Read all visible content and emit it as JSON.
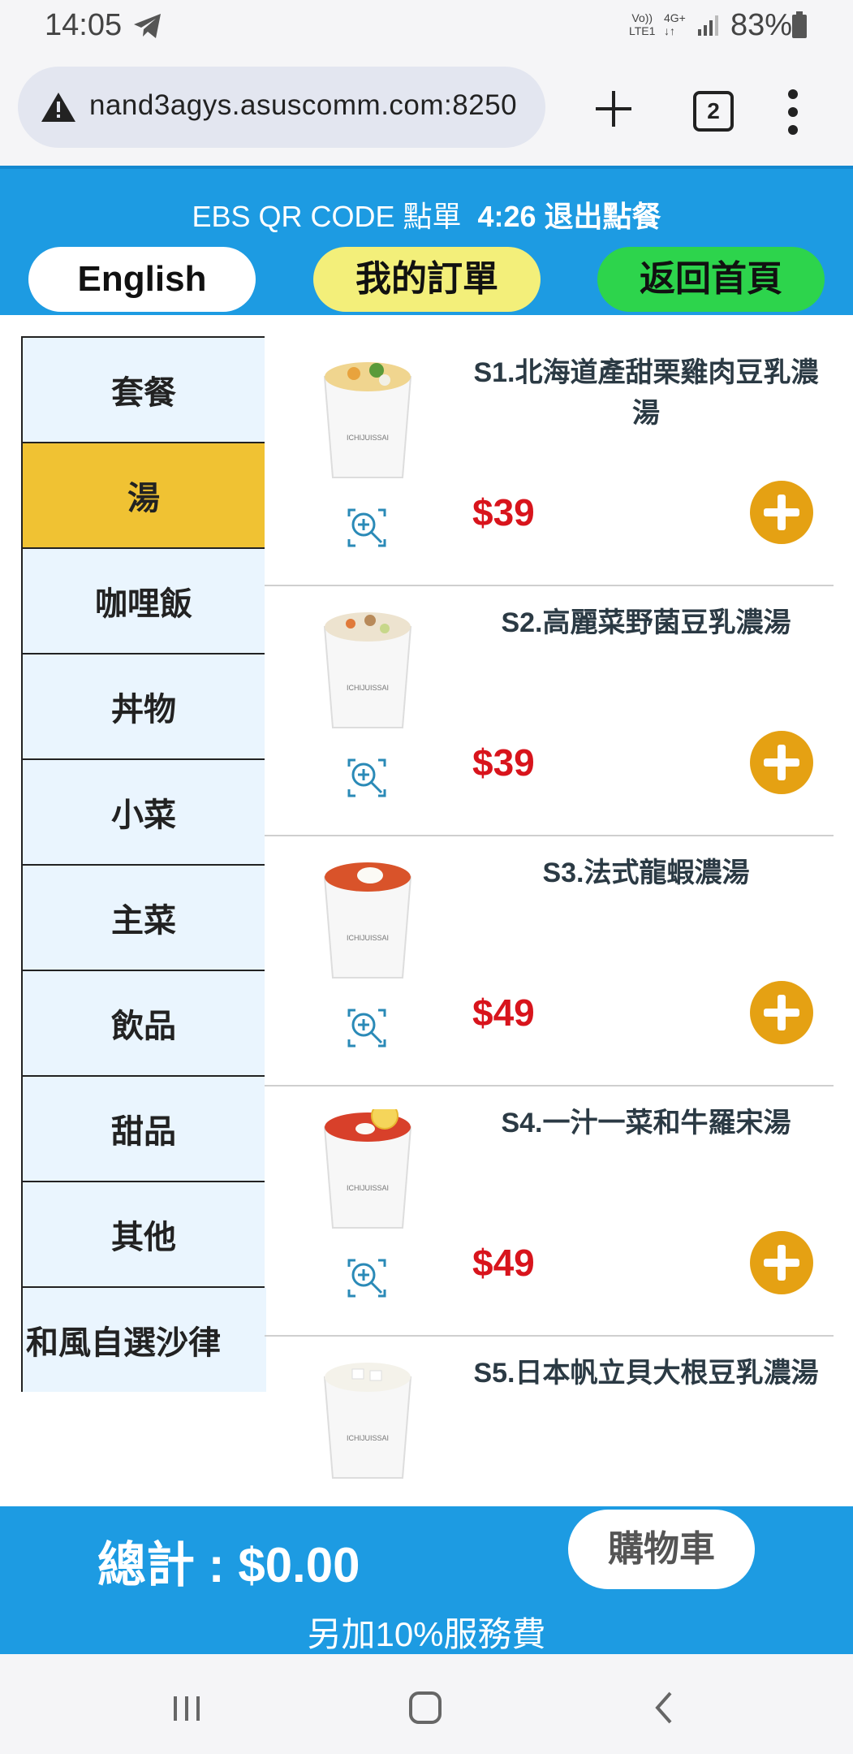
{
  "status_bar": {
    "time": "14:05",
    "network_top": "Vo))",
    "network_bottom": "LTE1",
    "network_type": "4G+",
    "battery": "83%"
  },
  "browser": {
    "url": "nand3agys.asuscomm.com:8250",
    "tabs_count": "2"
  },
  "header": {
    "title": "EBS QR CODE 點單",
    "timer_exit": "4:26 退出點餐",
    "buttons": {
      "english": "English",
      "my_orders": "我的訂單",
      "home": "返回首頁"
    },
    "colors": {
      "header_bg": "#1d9be2",
      "orders_bg": "#f3ef7a",
      "home_bg": "#2dd44c"
    }
  },
  "sidebar": {
    "categories": [
      {
        "label": "套餐"
      },
      {
        "label": "湯",
        "active": true
      },
      {
        "label": "咖哩飯"
      },
      {
        "label": "丼物"
      },
      {
        "label": "小菜"
      },
      {
        "label": "主菜"
      },
      {
        "label": "飲品"
      },
      {
        "label": "甜品"
      },
      {
        "label": "其他"
      },
      {
        "label": "和風自選沙律"
      }
    ]
  },
  "products": [
    {
      "name": "S1.北海道產甜栗雞肉豆乳濃湯",
      "price": "$39",
      "soup": "cream-veg"
    },
    {
      "name": "S2.高麗菜野菌豆乳濃湯",
      "price": "$39",
      "soup": "cream-mushroom"
    },
    {
      "name": "S3.法式龍蝦濃湯",
      "price": "$49",
      "soup": "bisque"
    },
    {
      "name": "S4.一汁一菜和牛羅宋湯",
      "price": "$49",
      "soup": "borscht"
    },
    {
      "name": "S5.日本帆立貝大根豆乳濃湯",
      "price": "",
      "soup": "white"
    }
  ],
  "cup_brand": "ICHIJUISSAI",
  "footer": {
    "total": "總計 : $0.00",
    "cart_button": "購物車",
    "service_fee": "另加10%服務費"
  }
}
